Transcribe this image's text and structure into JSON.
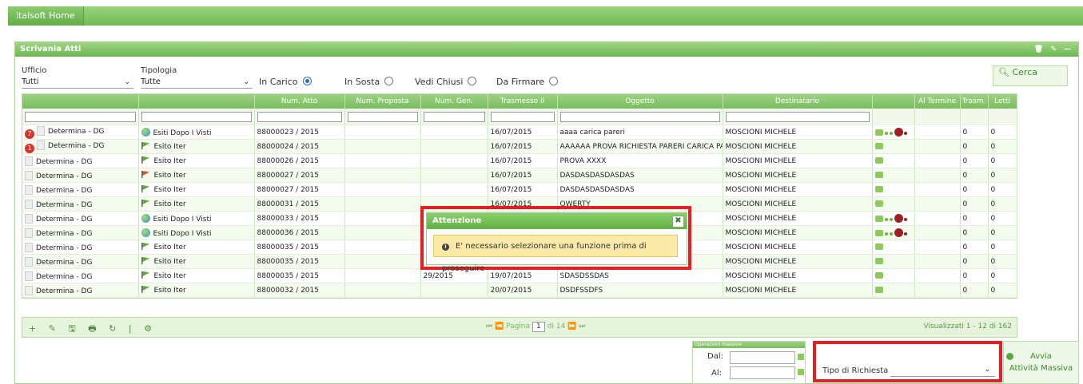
{
  "topbar": {
    "home_tab": "italsoft Home"
  },
  "panel": {
    "title": "Scrivania Atti",
    "header_icons": "🗑 ✎ —"
  },
  "filters": {
    "ufficio_label": "Ufficio",
    "ufficio_value": "Tutti",
    "tipologia_label": "Tipologia",
    "tipologia_value": "Tutte",
    "radios": [
      {
        "label": "In Carico",
        "checked": true
      },
      {
        "label": "In Sosta",
        "checked": false
      },
      {
        "label": "Vedi Chiusi",
        "checked": false
      },
      {
        "label": "Da Firmare",
        "checked": false
      }
    ],
    "cerca_label": "Cerca"
  },
  "table": {
    "columns": [
      "",
      "",
      "Num. Atto",
      "Num. Proposta",
      "Num. Gen.",
      "Trasmesso il",
      "Oggetto",
      "Destinatario",
      "",
      "Al Termine",
      "Trasm.",
      "Letti"
    ],
    "rows": [
      {
        "badge": "7",
        "tipo": "Determina - DG",
        "esito": "Esiti Dopo I Visti",
        "esito_icon": "globe",
        "num_atto": "88000023 / 2015",
        "num_prop": "",
        "num_gen": "",
        "trasmesso": "16/07/2015",
        "oggetto": "aaaa carica pareri",
        "dest": "MOSCIONI MICHELE",
        "stato": "gdr",
        "trasm": "0",
        "letti": "0"
      },
      {
        "badge": "1",
        "tipo": "Determina - DG",
        "esito": "Esito Iter",
        "esito_icon": "flag-green",
        "num_atto": "88000024 / 2015",
        "num_prop": "",
        "num_gen": "",
        "trasmesso": "16/07/2015",
        "oggetto": "AAAAAA PROVA RICHIESTA PARERI CARICA PARERI",
        "dest": "MOSCIONI MICHELE",
        "stato": "g",
        "trasm": "0",
        "letti": "0"
      },
      {
        "badge": "",
        "tipo": "Determina - DG",
        "esito": "Esito Iter",
        "esito_icon": "flag-green",
        "num_atto": "88000026 / 2015",
        "num_prop": "",
        "num_gen": "",
        "trasmesso": "16/07/2015",
        "oggetto": "PROVA XXXX",
        "dest": "MOSCIONI MICHELE",
        "stato": "g",
        "trasm": "0",
        "letti": "0"
      },
      {
        "badge": "",
        "tipo": "Determina - DG",
        "esito": "Esito Iter",
        "esito_icon": "flag-red",
        "num_atto": "88000027 / 2015",
        "num_prop": "",
        "num_gen": "",
        "trasmesso": "16/07/2015",
        "oggetto": "DASDASDASDASDAS",
        "dest": "MOSCIONI MICHELE",
        "stato": "g",
        "trasm": "0",
        "letti": "0"
      },
      {
        "badge": "",
        "tipo": "Determina - DG",
        "esito": "Esito Iter",
        "esito_icon": "flag-green",
        "num_atto": "88000027 / 2015",
        "num_prop": "",
        "num_gen": "",
        "trasmesso": "16/07/2015",
        "oggetto": "DASDASDASDASDAS",
        "dest": "MOSCIONI MICHELE",
        "stato": "g",
        "trasm": "0",
        "letti": "0"
      },
      {
        "badge": "",
        "tipo": "Determina - DG",
        "esito": "Esito Iter",
        "esito_icon": "flag-green",
        "num_atto": "88000031 / 2015",
        "num_prop": "",
        "num_gen": "",
        "trasmesso": "16/07/2015",
        "oggetto": "QWERTY",
        "dest": "MOSCIONI MICHELE",
        "stato": "g",
        "trasm": "0",
        "letti": "0"
      },
      {
        "badge": "",
        "tipo": "Determina - DG",
        "esito": "Esiti Dopo I Visti",
        "esito_icon": "globe",
        "num_atto": "88000033 / 2015",
        "num_prop": "",
        "num_gen": "",
        "trasmesso": "",
        "oggetto": "",
        "dest": "MOSCIONI MICHELE",
        "stato": "gdr",
        "trasm": "0",
        "letti": "0"
      },
      {
        "badge": "",
        "tipo": "Determina - DG",
        "esito": "Esiti Dopo I Visti",
        "esito_icon": "globe",
        "num_atto": "88000036 / 2015",
        "num_prop": "",
        "num_gen": "",
        "trasmesso": "",
        "oggetto": "",
        "dest": "MOSCIONI MICHELE",
        "stato": "gdr",
        "trasm": "0",
        "letti": "0"
      },
      {
        "badge": "",
        "tipo": "Determina - DG",
        "esito": "Esito Iter",
        "esito_icon": "flag-green",
        "num_atto": "88000035 / 2015",
        "num_prop": "",
        "num_gen": "",
        "trasmesso": "",
        "oggetto": "",
        "dest": "MOSCIONI MICHELE",
        "stato": "g",
        "trasm": "0",
        "letti": "0"
      },
      {
        "badge": "",
        "tipo": "Determina - DG",
        "esito": "Esito Iter",
        "esito_icon": "flag-green",
        "num_atto": "88000035 / 2015",
        "num_prop": "",
        "num_gen": "",
        "trasmesso": "",
        "oggetto": "",
        "dest": "MOSCIONI MICHELE",
        "stato": "g",
        "trasm": "0",
        "letti": "0"
      },
      {
        "badge": "",
        "tipo": "Determina - DG",
        "esito": "Esito Iter",
        "esito_icon": "flag-green",
        "num_atto": "88000035 / 2015",
        "num_prop": "",
        "num_gen": "29/2015",
        "trasmesso": "19/07/2015",
        "oggetto": "SDASDSSDAS",
        "dest": "MOSCIONI MICHELE",
        "stato": "g",
        "trasm": "0",
        "letti": "0"
      },
      {
        "badge": "",
        "tipo": "Determina - DG",
        "esito": "Esito Iter",
        "esito_icon": "flag-green",
        "num_atto": "88000032 / 2015",
        "num_prop": "",
        "num_gen": "",
        "trasmesso": "20/07/2015",
        "oggetto": "DSDFSSDFS",
        "dest": "MOSCIONI MICHELE",
        "stato": "g",
        "trasm": "0",
        "letti": "0"
      }
    ]
  },
  "footer": {
    "tools": "+ ✎ 🖫 🖶 ↻ | ⚙",
    "first_prev": "⏮ ⏪",
    "page_label": "Pagina",
    "page_value": "1",
    "of_label": "di 14",
    "next_last": "⏩ ⏭",
    "info": "Visualizzati 1 - 12 di 162"
  },
  "operations": {
    "title": "Operazioni massive",
    "dal_label": "Dal:",
    "al_label": "Al:",
    "tipo_label": "Tipo di Richiesta",
    "avvia_line1": "Avvia",
    "avvia_line2": "Attività Massiva"
  },
  "dialog": {
    "title": "Attenzione",
    "close": "✖",
    "message": "E' necessario selezionare una funzione prima di proseguire"
  },
  "colors": {
    "accent_green": "#78bd5e",
    "highlight_red": "#e41f1f",
    "warning_bg": "#fbe9a7"
  }
}
